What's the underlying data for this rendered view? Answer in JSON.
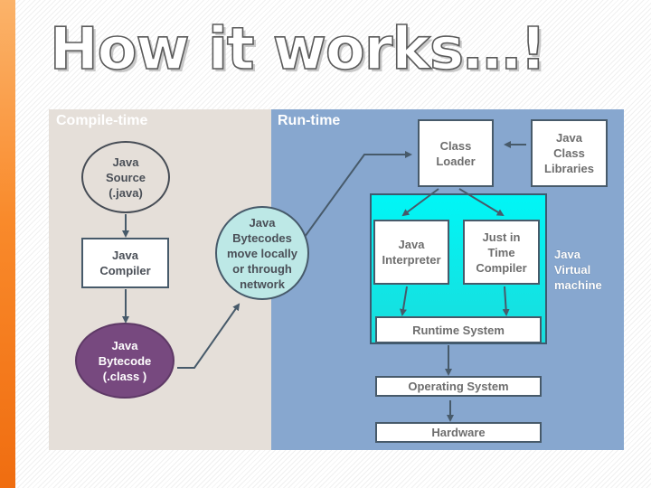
{
  "title": "How it works…!",
  "colors": {
    "accent_bar": "#f98a2b",
    "compile_panel": "#e5dfd9",
    "runtime_panel": "#87a7cf",
    "jvm_box": "#00f0f0",
    "bytecode_ellipse": "#77497f",
    "network_circle": "#bde8e6",
    "arrow": "#475a6a"
  },
  "diagram": {
    "compile_panel_label": "Compile-time",
    "runtime_panel_label": "Run-time",
    "java_source": "Java Source (.java)",
    "java_compiler": "Java Compiler",
    "java_bytecode": "Java Bytecode (.class )",
    "bytecodes_move": "Java Bytecodes move locally or through network",
    "class_loader": "Class Loader",
    "java_class_libraries": "Java Class Libraries",
    "java_interpreter": "Java Interpreter",
    "jit_compiler": "Just in Time Compiler",
    "runtime_system": "Runtime System",
    "operating_system": "Operating System",
    "hardware": "Hardware",
    "jvm_label": "Java Virtual machine"
  }
}
